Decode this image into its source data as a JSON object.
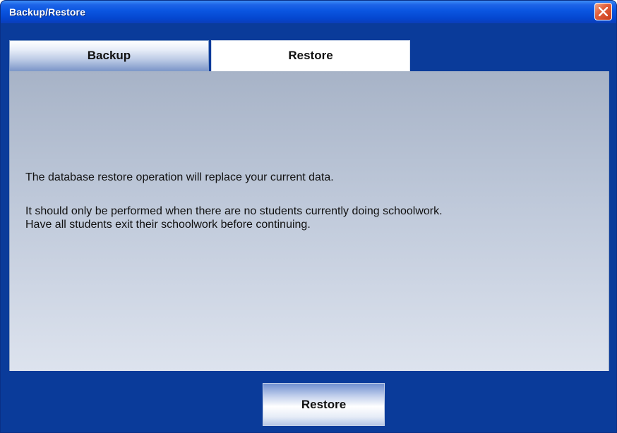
{
  "window": {
    "title": "Backup/Restore",
    "close_icon": "close-icon"
  },
  "tabs": [
    {
      "label": "Backup",
      "selected": false
    },
    {
      "label": "Restore",
      "selected": true
    }
  ],
  "content": {
    "line1": "The database restore operation will replace your current data.",
    "line2": "It should only be performed when there are no students currently doing schoolwork.",
    "line3": "Have all students exit their schoolwork before continuing."
  },
  "footer": {
    "restore_button": "Restore"
  },
  "colors": {
    "frame": "#0a3b9a",
    "titlebar": "#0a55e0",
    "close": "#d84a26"
  }
}
